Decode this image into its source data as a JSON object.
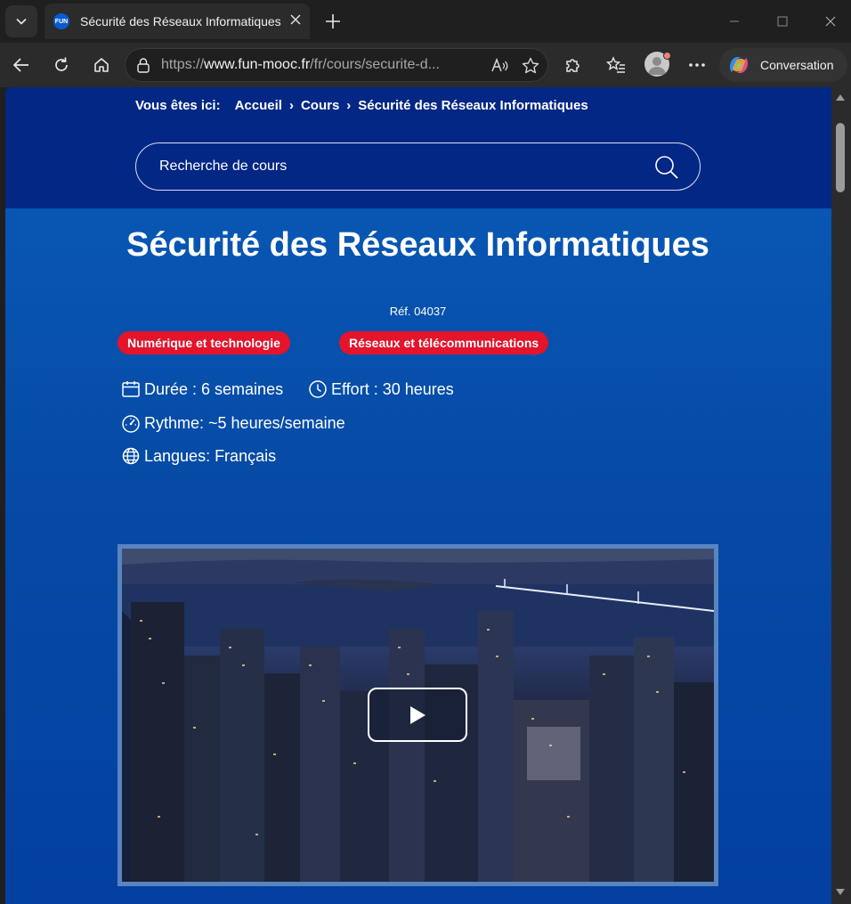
{
  "browser": {
    "tab_title": "Sécurité des Réseaux Informatiques",
    "favicon_text": "FUN",
    "url_prefix": "https://",
    "url_host": "www.fun-mooc.fr",
    "url_path": "/fr/cours/securite-d...",
    "conversation_label": "Conversation"
  },
  "breadcrumb": {
    "lead": "Vous êtes ici:",
    "items": [
      "Accueil",
      "Cours",
      "Sécurité des Réseaux Informatiques"
    ],
    "separator": "›"
  },
  "search": {
    "placeholder": "Recherche de cours"
  },
  "course": {
    "title": "Sécurité des Réseaux Informatiques",
    "ref": "Réf. 04037",
    "tags": [
      "Numérique et technologie",
      "Réseaux et télécommunications"
    ],
    "duration": "Durée : 6 semaines",
    "effort": "Effort : 30 heures",
    "rhythm": "Rythme: ~5 heures/semaine",
    "languages": "Langues: Français"
  },
  "colors": {
    "header_bg": "#022785",
    "hero_bg": "#0857b3",
    "tag_bg": "#e3142c",
    "video_border": "#5a84c0"
  }
}
